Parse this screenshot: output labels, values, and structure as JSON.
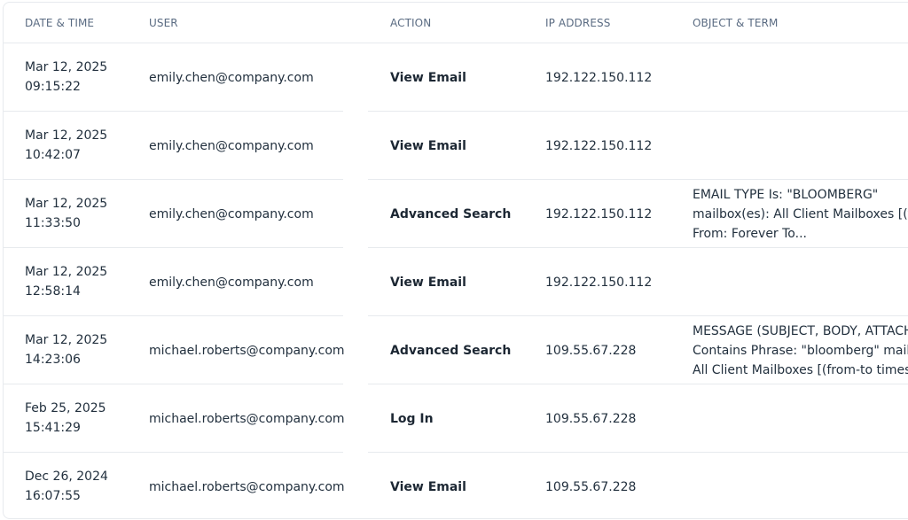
{
  "columns": {
    "date": "DATE & TIME",
    "user": "USER",
    "action": "ACTION",
    "ip": "IP ADDRESS",
    "object": "OBJECT & TERM"
  },
  "rows": [
    {
      "date": "Mar 12, 2025",
      "time": "09:15:22",
      "user": "emily.chen@company.com",
      "action": "View Email",
      "ip": "192.122.150.112",
      "object_lines": [
        "",
        "",
        ""
      ]
    },
    {
      "date": "Mar 12, 2025",
      "time": "10:42:07",
      "user": "emily.chen@company.com",
      "action": "View Email",
      "ip": "192.122.150.112",
      "object_lines": [
        "",
        "",
        ""
      ]
    },
    {
      "date": "Mar 12, 2025",
      "time": "11:33:50",
      "user": "emily.chen@company.com",
      "action": "Advanced Search",
      "ip": "192.122.150.112",
      "object_lines": [
        "EMAIL TYPE Is: \"BLOOMBERG\"",
        "mailbox(es): All Client Mailboxes [(f",
        "From: Forever To..."
      ]
    },
    {
      "date": "Mar 12, 2025",
      "time": "12:58:14",
      "user": "emily.chen@company.com",
      "action": "View Email",
      "ip": "192.122.150.112",
      "object_lines": [
        "",
        "",
        ""
      ]
    },
    {
      "date": "Mar 12, 2025",
      "time": "14:23:06",
      "user": "michael.roberts@company.com",
      "action": "Advanced Search",
      "ip": "109.55.67.228",
      "object_lines": [
        "MESSAGE (SUBJECT, BODY, ATTACH",
        "Contains Phrase: \"bloomberg\" mail",
        "All Client Mailboxes [(from-to times"
      ]
    },
    {
      "date": "Feb 25, 2025",
      "time": "15:41:29",
      "user": "michael.roberts@company.com",
      "action": "Log In",
      "ip": "109.55.67.228",
      "object_lines": [
        "",
        "",
        ""
      ]
    },
    {
      "date": "Dec 26, 2024",
      "time": "16:07:55",
      "user": "michael.roberts@company.com",
      "action": "View Email",
      "ip": "109.55.67.228",
      "object_lines": [
        "",
        "",
        ""
      ]
    }
  ]
}
